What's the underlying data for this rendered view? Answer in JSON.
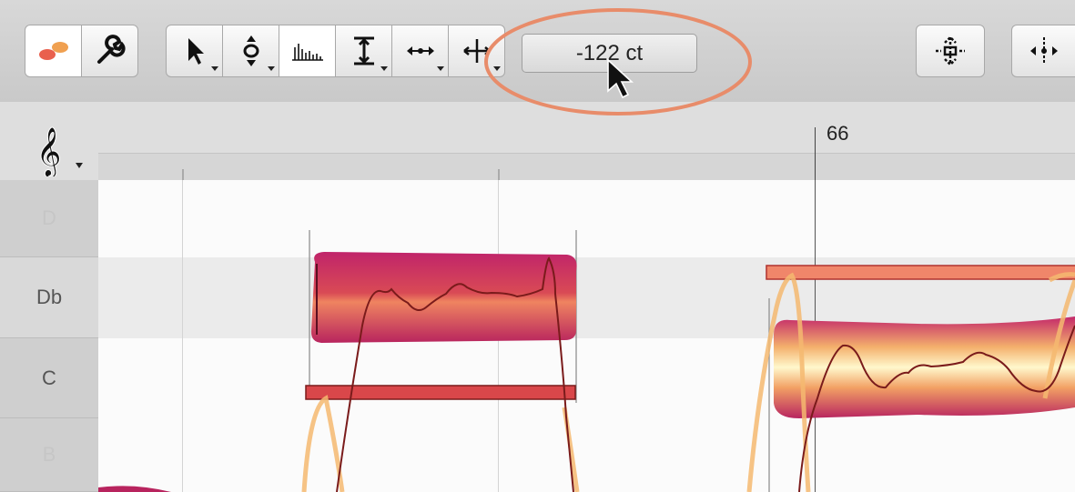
{
  "toolbar": {
    "pitch_readout": "-122 ct",
    "buttons": [
      {
        "name": "blob-view-icon"
      },
      {
        "name": "wrench-icon"
      },
      {
        "name": "main-tool-arrow-icon"
      },
      {
        "name": "pitch-tool-icon"
      },
      {
        "name": "amplitude-tool-icon"
      },
      {
        "name": "pitch-modulation-tool-icon"
      },
      {
        "name": "time-tool-icon"
      },
      {
        "name": "separation-tool-icon"
      },
      {
        "name": "quantize-pitch-icon"
      },
      {
        "name": "quantize-time-icon"
      }
    ]
  },
  "ruler": {
    "bar_number": "66",
    "clef_icon": "treble-clef-icon"
  },
  "piano_keys": [
    {
      "label": "D",
      "state": "dimmed"
    },
    {
      "label": "Db",
      "state": "highlighted"
    },
    {
      "label": "C",
      "state": "normal"
    },
    {
      "label": "B",
      "state": "dimmed"
    }
  ],
  "colors": {
    "annotation_ellipse": "#e88c6a",
    "blob_dark": "#b8245e",
    "blob_light": "#fff4c2",
    "pitch_curve": "#7a1b1b",
    "target_bar": "#d9474a"
  }
}
